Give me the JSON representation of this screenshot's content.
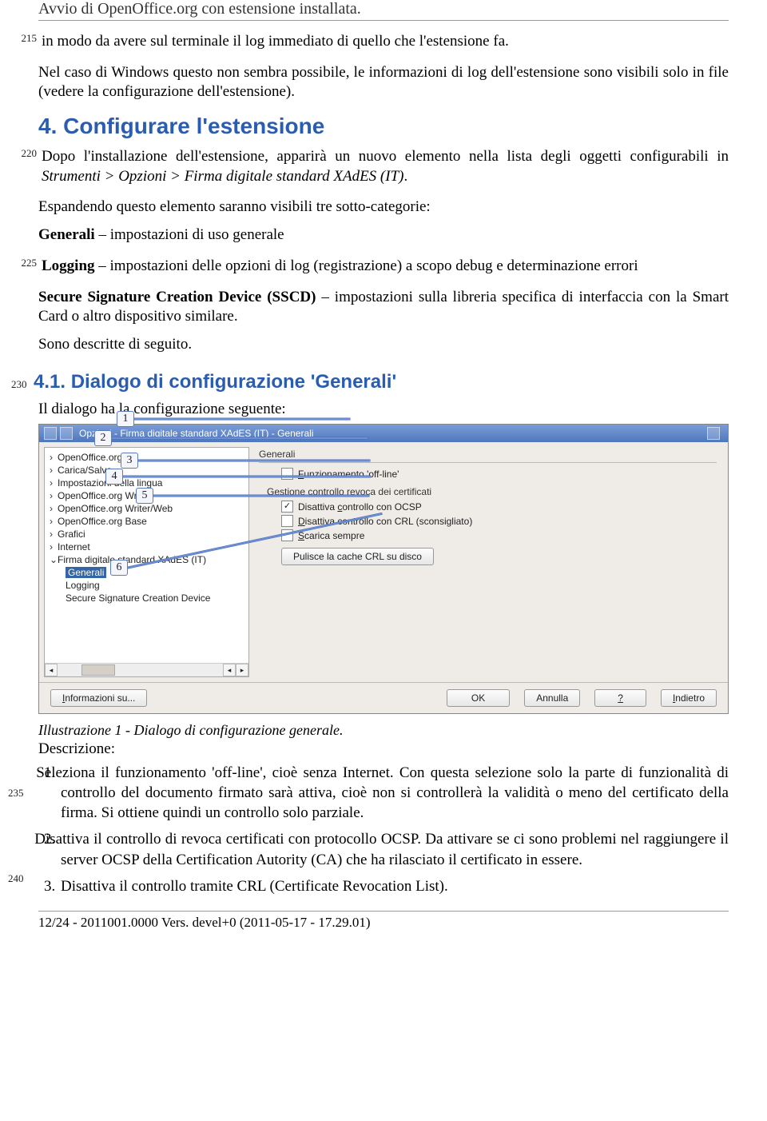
{
  "header": {
    "title": "Avvio di OpenOffice.org con estensione installata."
  },
  "lineNumbers": {
    "l215": "215",
    "l220": "220",
    "l225": "225",
    "l230": "230",
    "l235": "235",
    "l240": "240"
  },
  "para1": "in modo da avere sul terminale il log immediato di quello che l'estensione fa.",
  "para2": "Nel caso di Windows questo non sembra possibile, le informazioni di log dell'estensione sono visibili solo in file (vedere la configurazione dell'estensione).",
  "h2": "4. Configurare l'estensione",
  "para3a": "Dopo l'installazione dell'estensione, apparirà un nuovo elemento nella lista degli oggetti configurabili in ",
  "para3b_italic": "Strumenti > Opzioni > Firma digitale standard XAdES (IT)",
  "para3c": ".",
  "para4": "Espandendo questo elemento saranno visibili tre sotto-categorie:",
  "item_generali_b": "Generali",
  "item_generali_t": " – impostazioni di uso generale",
  "item_logging_b": "Logging",
  "item_logging_t": " – impostazioni delle opzioni di log (registrazione) a scopo debug e determinazione errori",
  "item_sscd_b": "Secure Signature Creation Device (SSCD)",
  "item_sscd_t": " – impostazioni sulla libreria specifica di interfaccia con la Smart Card o altro dispositivo similare.",
  "para5": "Sono descritte di seguito.",
  "h3": "4.1. Dialogo di configurazione 'Generali'",
  "para6": "Il dialogo ha la configurazione seguente:",
  "callouts": {
    "c1": "1",
    "c2": "2",
    "c3": "3",
    "c4": "4",
    "c5": "5",
    "c6": "6"
  },
  "dialog": {
    "title": "Opzioni - Firma digitale standard XAdES (IT) - Generali",
    "tree": {
      "items": [
        "OpenOffice.org",
        "Carica/Salva",
        "Impostazioni della lingua",
        "OpenOffice.org Writer",
        "OpenOffice.org Writer/Web",
        "OpenOffice.org Base",
        "Grafici",
        "Internet"
      ],
      "expanded_label": "Firma digitale standard XAdES (IT)",
      "children": [
        "Generali",
        "Logging",
        "Secure Signature Creation Device"
      ]
    },
    "group_title": "Generali",
    "chk_offline": "Funzionamento 'off-line'",
    "sub_revoca": "Gestione controllo revoca dei certificati",
    "chk_ocsp": "Disattiva controllo con OCSP",
    "chk_crl": "Disattiva controllo con CRL (sconsigliato)",
    "chk_scarica": "Scarica sempre",
    "btn_cache": "Pulisce la cache CRL su disco",
    "btn_info": "Informazioni su...",
    "btn_ok": "OK",
    "btn_cancel": "Annulla",
    "btn_help": "?",
    "btn_back": "Indietro"
  },
  "caption": "Illustrazione 1 - Dialogo di configurazione generale.",
  "descrizione": "Descrizione:",
  "list": {
    "li1": "Seleziona il funzionamento 'off-line', cioè senza Internet. Con questa selezione solo la parte di funzionalità di controllo del documento firmato sarà attiva, cioè non si controllerà la validità o meno del certificato della firma. Si ottiene quindi un controllo solo parziale.",
    "li2": "Disattiva il controllo di revoca certificati con protocollo OCSP. Da attivare se ci sono problemi nel raggiungere il server OCSP della Certification Autority (CA) che ha rilasciato il certificato in essere.",
    "li3": "Disattiva il controllo tramite CRL (Certificate Revocation List)."
  },
  "footer": "12/24 - 2011001.0000 Vers. devel+0 (2011-05-17 - 17.29.01)"
}
